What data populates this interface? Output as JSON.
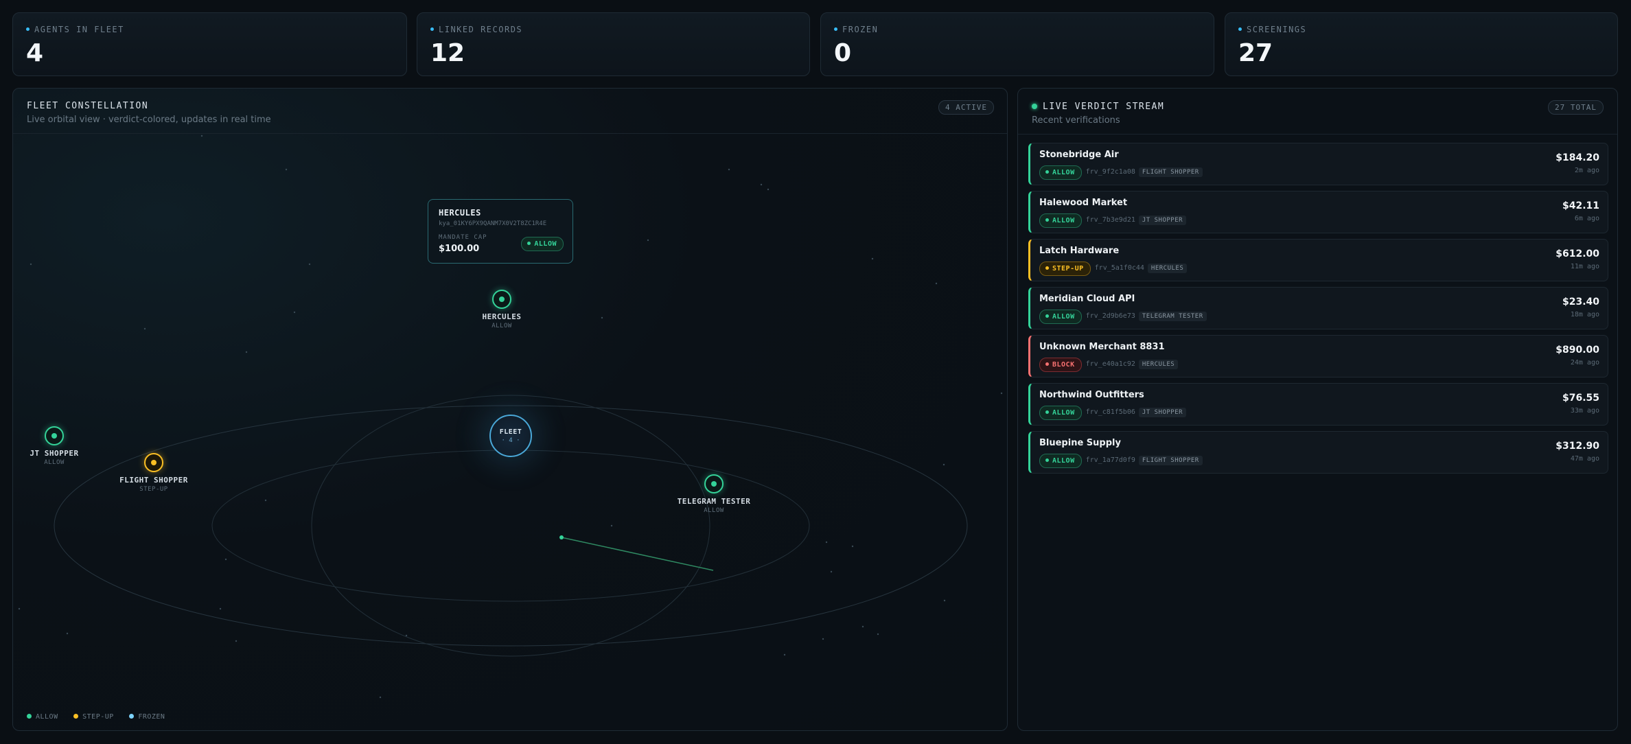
{
  "stats": [
    {
      "label": "AGENTS IN FLEET",
      "value": "4"
    },
    {
      "label": "LINKED RECORDS",
      "value": "12"
    },
    {
      "label": "FROZEN",
      "value": "0"
    },
    {
      "label": "SCREENINGS",
      "value": "27"
    }
  ],
  "fleet": {
    "title": "FLEET CONSTELLATION",
    "subtitle": "Live orbital view · verdict-colored, updates in real time",
    "active_pill": "4 ACTIVE",
    "hub": {
      "label": "FLEET",
      "count": "· 4 ·"
    },
    "agents": [
      {
        "name": "HERCULES",
        "status": "ALLOW"
      },
      {
        "name": "JT SHOPPER",
        "status": "ALLOW"
      },
      {
        "name": "FLIGHT SHOPPER",
        "status": "STEP-UP"
      },
      {
        "name": "TELEGRAM TESTER",
        "status": "ALLOW"
      }
    ],
    "tooltip": {
      "name": "HERCULES",
      "id": "kya_01KY6PX9QANM7X0V2T8ZC1R4E",
      "cap_label": "MANDATE CAP",
      "cap_value": "$100.00",
      "badge": "ALLOW"
    },
    "legend": [
      "ALLOW",
      "STEP-UP",
      "FROZEN"
    ],
    "colors": {
      "allow": "#34d399",
      "stepup": "#fbbf24",
      "frozen": "#7dd3fc",
      "block": "#f87171"
    }
  },
  "stream": {
    "title": "LIVE VERDICT STREAM",
    "subtitle": "Recent verifications",
    "total_pill": "27 TOTAL",
    "items": [
      {
        "merchant": "Stonebridge Air",
        "verdict": "ALLOW",
        "ref": "frv_9f2c1a08",
        "agent": "FLIGHT SHOPPER",
        "amount": "$184.20",
        "ago": "2m ago"
      },
      {
        "merchant": "Halewood Market",
        "verdict": "ALLOW",
        "ref": "frv_7b3e9d21",
        "agent": "JT SHOPPER",
        "amount": "$42.11",
        "ago": "6m ago"
      },
      {
        "merchant": "Latch Hardware",
        "verdict": "STEP-UP",
        "ref": "frv_5a1f0c44",
        "agent": "HERCULES",
        "amount": "$612.00",
        "ago": "11m ago"
      },
      {
        "merchant": "Meridian Cloud API",
        "verdict": "ALLOW",
        "ref": "frv_2d9b6e73",
        "agent": "TELEGRAM TESTER",
        "amount": "$23.40",
        "ago": "18m ago"
      },
      {
        "merchant": "Unknown Merchant 8831",
        "verdict": "BLOCK",
        "ref": "frv_e40a1c92",
        "agent": "HERCULES",
        "amount": "$890.00",
        "ago": "24m ago"
      },
      {
        "merchant": "Northwind Outfitters",
        "verdict": "ALLOW",
        "ref": "frv_c81f5b06",
        "agent": "JT SHOPPER",
        "amount": "$76.55",
        "ago": "33m ago"
      },
      {
        "merchant": "Bluepine Supply",
        "verdict": "ALLOW",
        "ref": "frv_1a77d0f9",
        "agent": "FLIGHT SHOPPER",
        "amount": "$312.90",
        "ago": "47m ago"
      }
    ]
  }
}
